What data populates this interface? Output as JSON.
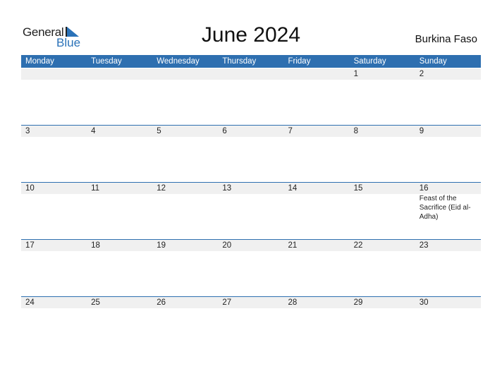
{
  "logo": {
    "line1": "General",
    "line2": "Blue"
  },
  "title": "June 2024",
  "country": "Burkina Faso",
  "colors": {
    "accent": "#2e6fb0",
    "band": "#f0f0f0"
  },
  "weekdays": [
    "Monday",
    "Tuesday",
    "Wednesday",
    "Thursday",
    "Friday",
    "Saturday",
    "Sunday"
  ],
  "weeks": [
    [
      {
        "d": ""
      },
      {
        "d": ""
      },
      {
        "d": ""
      },
      {
        "d": ""
      },
      {
        "d": ""
      },
      {
        "d": "1"
      },
      {
        "d": "2"
      }
    ],
    [
      {
        "d": "3"
      },
      {
        "d": "4"
      },
      {
        "d": "5"
      },
      {
        "d": "6"
      },
      {
        "d": "7"
      },
      {
        "d": "8"
      },
      {
        "d": "9"
      }
    ],
    [
      {
        "d": "10"
      },
      {
        "d": "11"
      },
      {
        "d": "12"
      },
      {
        "d": "13"
      },
      {
        "d": "14"
      },
      {
        "d": "15"
      },
      {
        "d": "16",
        "e": "Feast of the Sacrifice (Eid al-Adha)"
      }
    ],
    [
      {
        "d": "17"
      },
      {
        "d": "18"
      },
      {
        "d": "19"
      },
      {
        "d": "20"
      },
      {
        "d": "21"
      },
      {
        "d": "22"
      },
      {
        "d": "23"
      }
    ],
    [
      {
        "d": "24"
      },
      {
        "d": "25"
      },
      {
        "d": "26"
      },
      {
        "d": "27"
      },
      {
        "d": "28"
      },
      {
        "d": "29"
      },
      {
        "d": "30"
      }
    ]
  ]
}
